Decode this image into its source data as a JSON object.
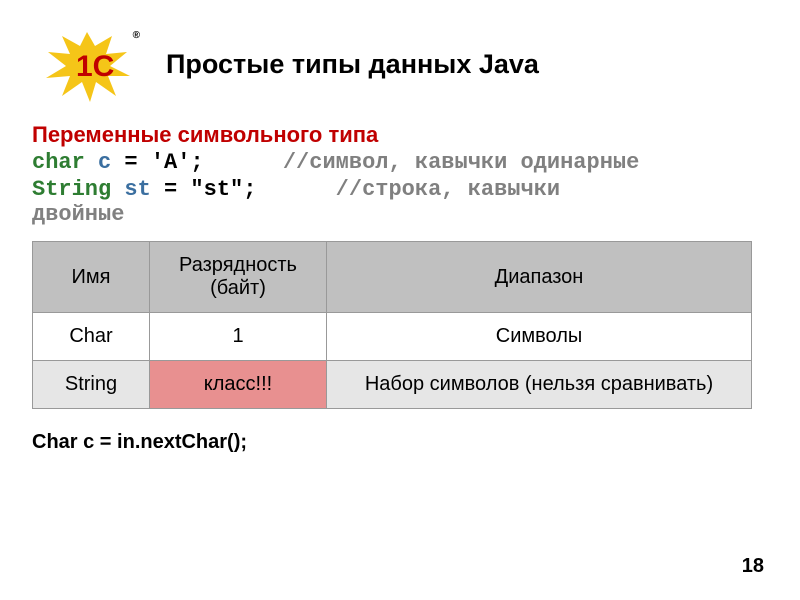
{
  "header": {
    "title": "Простые типы данных Java",
    "logo_text": "1C",
    "reg_mark": "®"
  },
  "section": {
    "subtitle": "Переменные символьного типа"
  },
  "code": {
    "line1_type": "char",
    "line1_var": "c",
    "line1_rest": " = 'А';",
    "line1_comment": "//символ, кавычки одинарные",
    "line2_type": "String",
    "line2_var": "st",
    "line2_rest": " = \"st\";",
    "line2_comment": "//строка, кавычки",
    "line2_comment_tail": "двойные"
  },
  "table": {
    "headers": {
      "name": "Имя",
      "bits": "Разрядность (байт)",
      "range": "Диапазон"
    },
    "rows": [
      {
        "name": "Char",
        "bits": "1",
        "range": "Символы"
      },
      {
        "name": "String",
        "bits": "класс!!!",
        "range": "Набор символов (нельзя сравнивать)"
      }
    ]
  },
  "footer": {
    "code": "Char c = in.nextChar();",
    "page_number": "18"
  },
  "chart_data": {
    "type": "table",
    "title": "Простые типы данных Java — символьные типы",
    "columns": [
      "Имя",
      "Разрядность (байт)",
      "Диапазон"
    ],
    "rows": [
      [
        "Char",
        "1",
        "Символы"
      ],
      [
        "String",
        "класс!!!",
        "Набор символов (нельзя сравнивать)"
      ]
    ]
  }
}
